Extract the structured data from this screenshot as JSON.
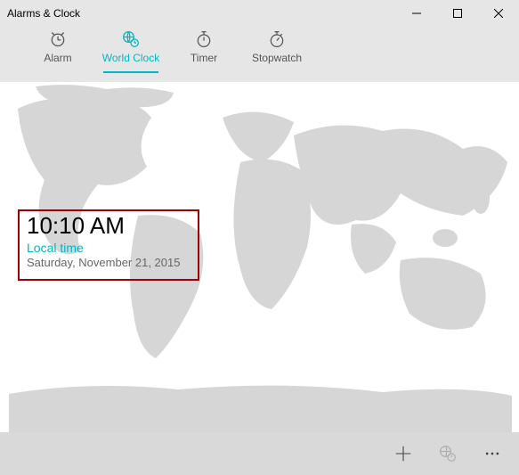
{
  "window": {
    "title": "Alarms & Clock"
  },
  "tabs": {
    "alarm": "Alarm",
    "worldclock": "World Clock",
    "timer": "Timer",
    "stopwatch": "Stopwatch"
  },
  "clock": {
    "time": "10:10 AM",
    "label": "Local time",
    "date": "Saturday, November 21, 2015"
  },
  "colors": {
    "accent": "#00b7c3",
    "highlight_border": "#a00000"
  }
}
